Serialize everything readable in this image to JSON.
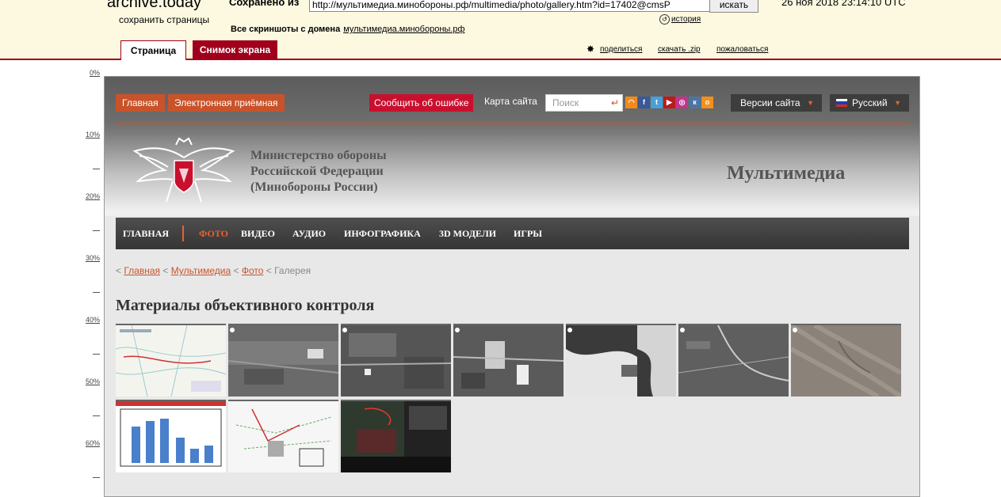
{
  "archive": {
    "logo": "archive.today",
    "logo_sub": "сохранить страницы",
    "saved_from_label": "Сохранено из",
    "url": "http://мультимедиа.минобороны.рф/multimedia/photo/gallery.htm?id=17402@cmsP",
    "search_button": "искать",
    "timestamp": "26 ноя 2018 23:14:10 UTC",
    "history": "история",
    "all_screenshots": "Все скриншоты  с домена",
    "domain": "мультимедиа.минобороны.рф",
    "tabs": [
      "Страница",
      "Снимок экрана"
    ],
    "links": {
      "share": "поделиться",
      "download": "скачать .zip",
      "report": "пожаловаться"
    }
  },
  "ruler": {
    "labels": [
      "0%",
      "10%",
      "20%",
      "30%",
      "40%",
      "50%",
      "60%"
    ]
  },
  "site": {
    "top_buttons": {
      "home": "Главная",
      "reception": "Электронная приёмная",
      "report_error": "Сообщить об ошибке",
      "sitemap": "Карта сайта"
    },
    "search_placeholder": "Поиск",
    "social_icons": [
      "rss-icon",
      "facebook-icon",
      "twitter-icon",
      "youtube-icon",
      "instagram-icon",
      "vk-icon",
      "odnoklassniki-icon"
    ],
    "versions": "Версии сайта",
    "language": "Русский",
    "ministry_lines": [
      "Министерство обороны",
      "Российской Федерации",
      "(Минобороны России)"
    ],
    "section_title": "Мультимедиа",
    "menu": [
      "ГЛАВНАЯ",
      "ФОТО",
      "ВИДЕО",
      "АУДИО",
      "ИНФОГРАФИКА",
      "3D МОДЕЛИ",
      "ИГРЫ"
    ],
    "menu_active": "ФОТО",
    "breadcrumb": {
      "home": "Главная",
      "multimedia": "Мультимедиа",
      "photo": "Фото",
      "current": "Галерея"
    },
    "page_title": "Материалы объективного контроля"
  },
  "colors": {
    "archive_red": "#a0001c",
    "site_orange": "#c8532a",
    "menu_active": "#e8622e",
    "error_red": "#c8102e"
  }
}
